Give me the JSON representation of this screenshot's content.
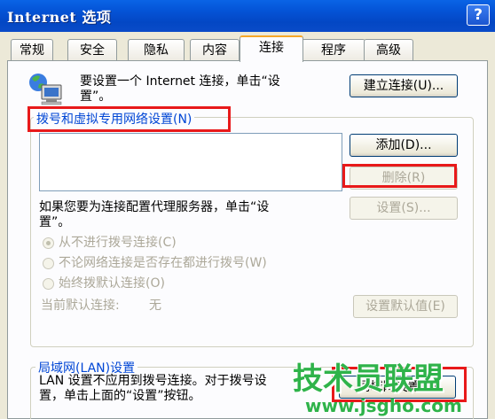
{
  "window": {
    "title": "Internet 选项",
    "help_label": "?"
  },
  "tabs": [
    {
      "label": "常规"
    },
    {
      "label": "安全"
    },
    {
      "label": "隐私"
    },
    {
      "label": "内容"
    },
    {
      "label": "连接",
      "active": true
    },
    {
      "label": "程序"
    },
    {
      "label": "高级"
    }
  ],
  "setup": {
    "text_line1": "要设置一个 Internet 连接，单击“设",
    "text_line2": "置”。",
    "button": "建立连接(U)..."
  },
  "dialup": {
    "legend": "拨号和虚拟专用网络设置(N)",
    "add_button": "添加(D)...",
    "remove_button": "删除(R)",
    "settings_button": "设置(S)...",
    "proxy_line1": "如果您要为连接配置代理服务器，单击“设",
    "proxy_line2": "置”。",
    "radio_never": "从不进行拨号连接(C)",
    "radio_when_absent": "不论网络连接是否存在都进行拨号(W)",
    "radio_always": "始终拨默认连接(O)",
    "current_default_label": "当前默认连接:",
    "current_default_value": "无",
    "set_default_button": "设置默认值(E)"
  },
  "lan": {
    "legend": "局域网(LAN)设置",
    "text_line1": "LAN 设置不应用到拨号连接。对于拨号设",
    "text_line2": "置，单击上面的“设置”按钮。",
    "button": "局域网设置(L)"
  },
  "watermark": {
    "title": "技术员联盟",
    "url": "www.jsgho.com"
  },
  "colors": {
    "titlebar": "#0453d6",
    "highlight": "#e8191a",
    "legend": "#0046d5",
    "disabled": "#aca899"
  }
}
